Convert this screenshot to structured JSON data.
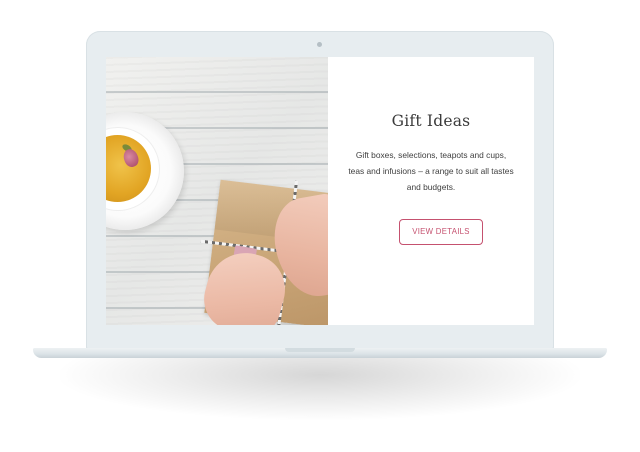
{
  "card": {
    "title": "Gift Ideas",
    "description": "Gift boxes, selections, teapots and cups, teas and infusions – a range to suit all tastes and budgets.",
    "button_label": "VIEW DETAILS"
  },
  "colors": {
    "accent": "#c5516f",
    "laptop_frame": "#e7edf0",
    "text": "#3b3b3b"
  },
  "icons": [
    "camera-icon"
  ]
}
